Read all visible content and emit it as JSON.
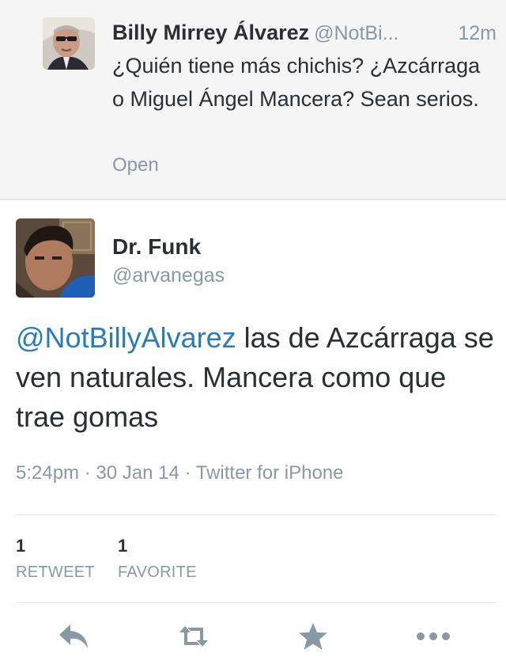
{
  "parent_tweet": {
    "name": "Billy Mirrey Álvarez",
    "handle": "@NotBi...",
    "time": "12m",
    "text": "¿Quién tiene más chichis? ¿Azcárraga o Miguel Ángel Mancera? Sean serios.",
    "open_label": "Open"
  },
  "tweet": {
    "name": "Dr. Funk",
    "handle": "@arvanegas",
    "mention": "@NotBillyAlvarez",
    "text": " las de Azcárraga se ven naturales. Mancera como que trae gomas",
    "time": "5:24pm",
    "date": "30 Jan 14",
    "source": "Twitter for iPhone",
    "separator": "·"
  },
  "stats": {
    "retweets": {
      "count": "1",
      "label": "RETWEET"
    },
    "favorites": {
      "count": "1",
      "label": "FAVORITE"
    }
  },
  "actions": [
    {
      "icon": "reply-icon"
    },
    {
      "icon": "retweet-icon"
    },
    {
      "icon": "star-icon"
    },
    {
      "icon": "more-icon"
    }
  ],
  "colors": {
    "link": "#2b7bb9",
    "muted": "#8899a6",
    "text": "#292f33",
    "parent_background": "#f5f5f5",
    "icon": "#8899a6"
  }
}
